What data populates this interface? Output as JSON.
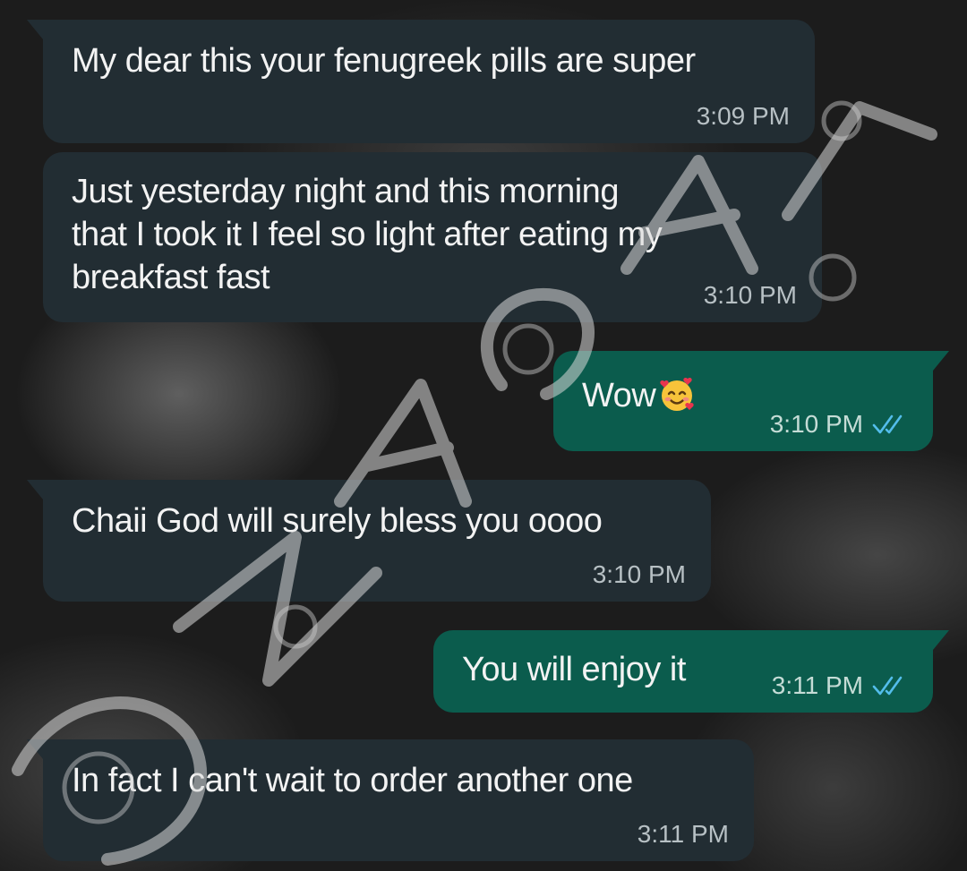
{
  "messages": [
    {
      "direction": "incoming",
      "text": "My dear this your fenugreek pills are super",
      "time": "3:09 PM"
    },
    {
      "direction": "incoming",
      "text": "Just yesterday night and this morning\nthat I took it I feel so light after eating my\nbreakfast fast",
      "time": "3:10 PM"
    },
    {
      "direction": "outgoing",
      "text": "Wow",
      "emoji": "smiling-face-with-hearts-icon",
      "time": "3:10 PM",
      "status": "read"
    },
    {
      "direction": "incoming",
      "text": "Chaii God will surely bless you oooo",
      "time": "3:10 PM"
    },
    {
      "direction": "outgoing",
      "text": "You will enjoy it",
      "time": "3:11 PM",
      "status": "read"
    },
    {
      "direction": "incoming",
      "text": "In fact I can't wait to order another one",
      "time": "3:11 PM"
    }
  ],
  "colors": {
    "incoming_bubble": "#222d33",
    "outgoing_bubble": "#0b5c4d",
    "read_ticks": "#53bdeb"
  }
}
